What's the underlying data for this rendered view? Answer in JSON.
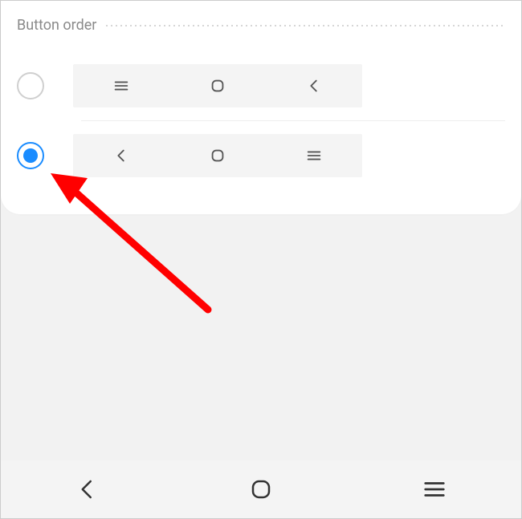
{
  "section": {
    "title": "Button order"
  },
  "options": [
    {
      "selected": false,
      "order": [
        "recents",
        "home",
        "back"
      ]
    },
    {
      "selected": true,
      "order": [
        "back",
        "home",
        "recents"
      ]
    }
  ],
  "bottomNav": {
    "order": [
      "back",
      "home",
      "recents"
    ]
  },
  "annotation": {
    "arrowColor": "#ff0000"
  }
}
